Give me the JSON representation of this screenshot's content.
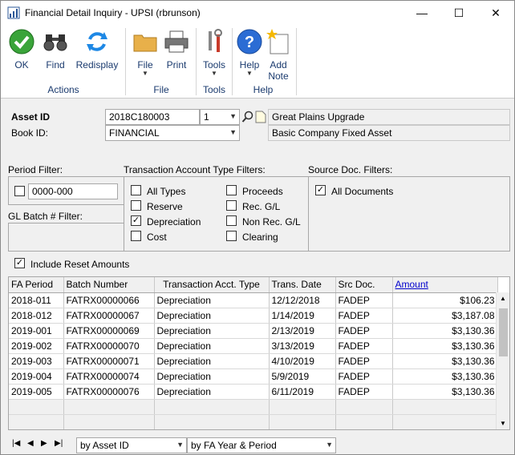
{
  "window": {
    "title": "Financial Detail Inquiry  -  UPSI (rbrunson)",
    "minimize": "—",
    "maximize": "☐",
    "close": "✕"
  },
  "ribbon": {
    "ok": "OK",
    "find": "Find",
    "redisplay": "Redisplay",
    "file": "File",
    "print": "Print",
    "tools": "Tools",
    "help": "Help",
    "add_note_1": "Add",
    "add_note_2": "Note",
    "groups": {
      "actions": "Actions",
      "file": "File",
      "tools": "Tools",
      "help": "Help"
    }
  },
  "header": {
    "asset_id_label": "Asset ID",
    "asset_id_value": "2018C180003",
    "suffix_value": "1",
    "asset_desc": "Great Plains Upgrade",
    "book_id_label": "Book ID:",
    "book_id_value": "FINANCIAL",
    "book_desc": "Basic Company Fixed Asset"
  },
  "filters": {
    "period_label": "Period Filter:",
    "period_value": "0000-000",
    "trx_label": "Transaction Account Type Filters:",
    "source_label": "Source Doc. Filters:",
    "gl_batch_label": "GL Batch # Filter:",
    "all_types": "All Types",
    "reserve": "Reserve",
    "depreciation": "Depreciation",
    "cost": "Cost",
    "proceeds": "Proceeds",
    "rec_gl": "Rec. G/L",
    "non_rec_gl": "Non Rec. G/L",
    "clearing": "Clearing",
    "all_documents": "All Documents",
    "include_reset": "Include Reset Amounts"
  },
  "grid": {
    "headers": [
      "FA Period",
      "Batch Number",
      "Transaction Acct. Type",
      "Trans. Date",
      "Src Doc.",
      "Amount"
    ],
    "rows": [
      [
        "2018-011",
        "FATRX00000066",
        "Depreciation",
        "12/12/2018",
        "FADEP",
        "$106.23"
      ],
      [
        "2018-012",
        "FATRX00000067",
        "Depreciation",
        "1/14/2019",
        "FADEP",
        "$3,187.08"
      ],
      [
        "2019-001",
        "FATRX00000069",
        "Depreciation",
        "2/13/2019",
        "FADEP",
        "$3,130.36"
      ],
      [
        "2019-002",
        "FATRX00000070",
        "Depreciation",
        "3/13/2019",
        "FADEP",
        "$3,130.36"
      ],
      [
        "2019-003",
        "FATRX00000071",
        "Depreciation",
        "4/10/2019",
        "FADEP",
        "$3,130.36"
      ],
      [
        "2019-004",
        "FATRX00000074",
        "Depreciation",
        "5/9/2019",
        "FADEP",
        "$3,130.36"
      ],
      [
        "2019-005",
        "FATRX00000076",
        "Depreciation",
        "6/11/2019",
        "FADEP",
        "$3,130.36"
      ]
    ]
  },
  "bottom": {
    "sort1": "by Asset ID",
    "sort2": "by FA Year & Period"
  },
  "colors": {
    "ribbon_text": "#1a3a6e",
    "link": "#0000cc"
  }
}
